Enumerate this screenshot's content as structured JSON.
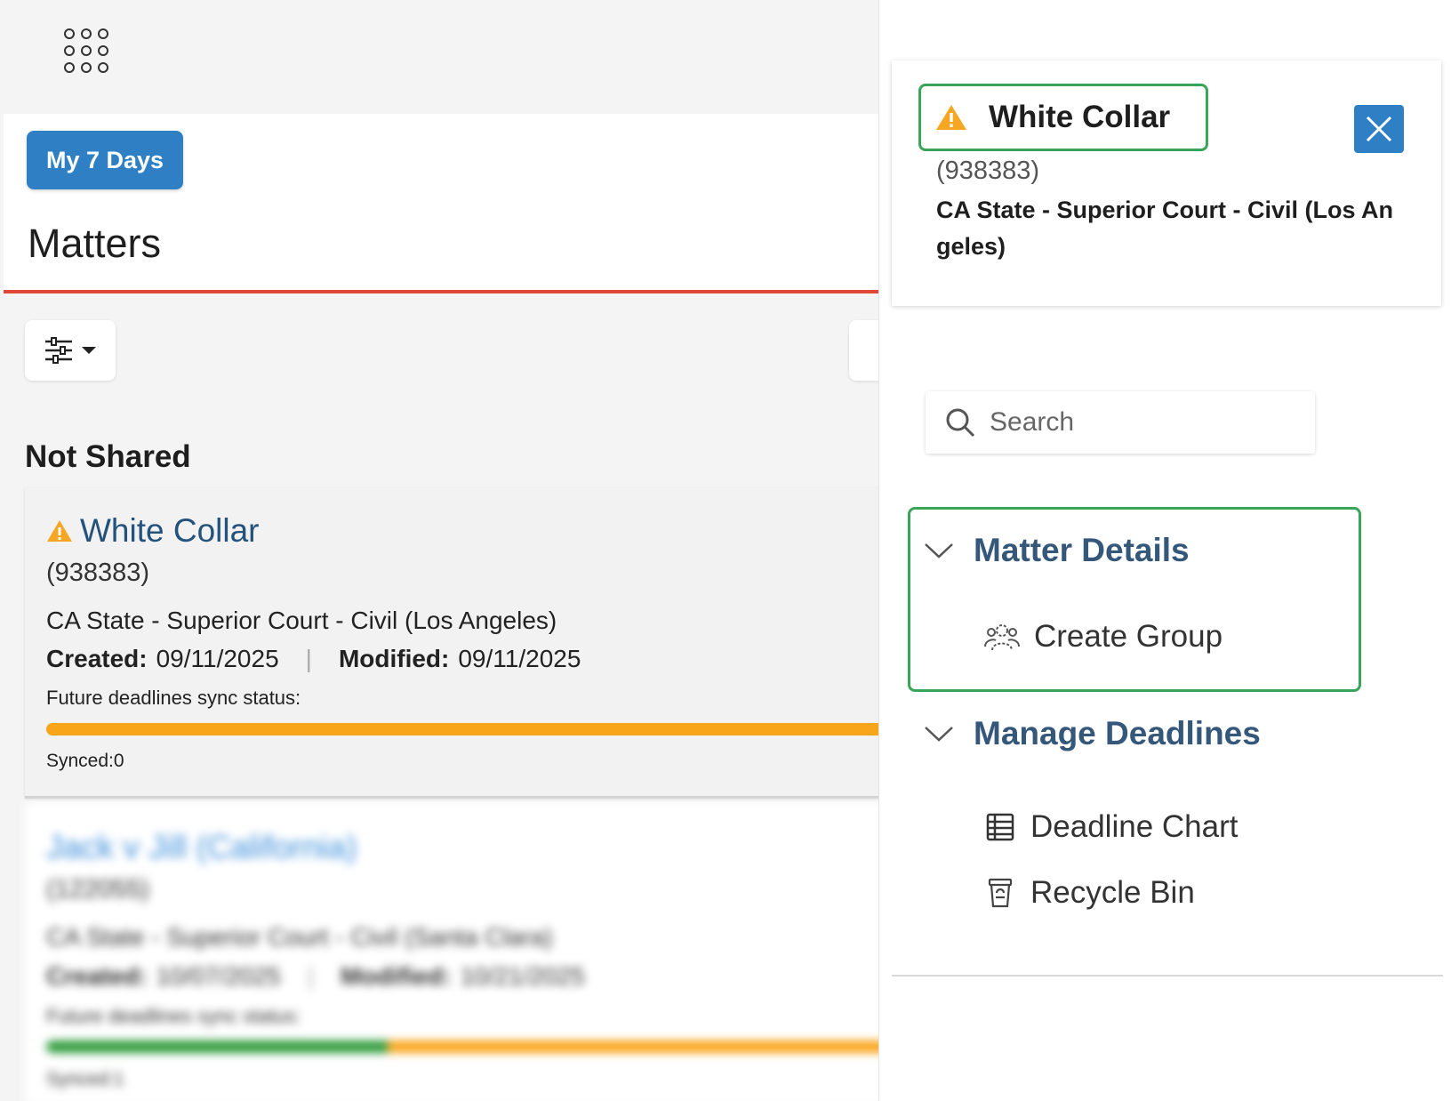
{
  "left": {
    "my7_button": "My 7 Days",
    "page_title": "Matters",
    "section_heading": "Not Shared",
    "matters": [
      {
        "title": "White Collar",
        "id": "(938383)",
        "court": "CA State - Superior Court - Civil (Los Angeles)",
        "created_label": "Created:",
        "created": "09/11/2025",
        "separator": "|",
        "modified_label": "Modified:",
        "modified": "09/11/2025",
        "sync_label": "Future deadlines sync status:",
        "synced": "Synced:0",
        "synced_fraction": 0
      },
      {
        "title": "Jack v Jill (California)",
        "id": "(122055)",
        "court": "CA State - Superior Court - Civil (Santa Clara)",
        "created_label": "Created:",
        "created": "10/07/2025",
        "separator": "|",
        "modified_label": "Modified:",
        "modified": "10/21/2025",
        "sync_label": "Future deadlines sync status:",
        "synced": "Synced:1",
        "synced_fraction": 0.4
      }
    ]
  },
  "right": {
    "detail": {
      "title": "White Collar",
      "id": "(938383)",
      "court": "CA State - Superior Court - Civil (Los Angeles)"
    },
    "search": {
      "placeholder": "Search"
    },
    "sections": [
      {
        "title": "Matter Details",
        "items": [
          "Create Group"
        ]
      },
      {
        "title": "Manage Deadlines",
        "items": [
          "Deadline Chart",
          "Recycle Bin"
        ]
      }
    ]
  },
  "colors": {
    "primary": "#2f7fc4",
    "accent_red": "#e0473a",
    "warning": "#f5a623",
    "sync_orange": "#f9a51a",
    "sync_green": "#2e9b3a",
    "highlight_green": "#3aa55a",
    "section_title": "#34577a",
    "link": "#24527a"
  },
  "icons": [
    "apps-grid-icon",
    "filter-sliders-icon",
    "warning-icon",
    "close-icon",
    "search-icon",
    "chevron-down-icon",
    "group-icon",
    "table-icon",
    "trash-icon"
  ]
}
